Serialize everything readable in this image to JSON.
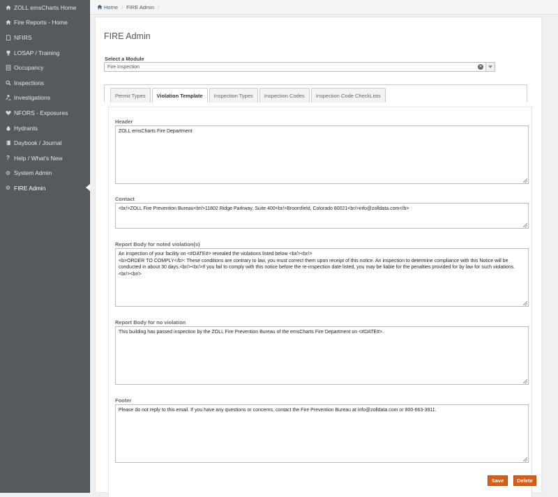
{
  "sidebar": {
    "items": [
      {
        "label": "ZOLL emsCharts Home",
        "icon": "home-icon"
      },
      {
        "label": "Fire Reports - Home",
        "icon": "home-icon"
      },
      {
        "label": "NFIRS",
        "icon": "file-icon"
      },
      {
        "label": "LOSAP / Training",
        "icon": "trophy-icon"
      },
      {
        "label": "Occupancy",
        "icon": "building-icon"
      },
      {
        "label": "Inspections",
        "icon": "search-icon"
      },
      {
        "label": "Investigations",
        "icon": "gavel-icon"
      },
      {
        "label": "NFORS - Exposures",
        "icon": "heart-icon"
      },
      {
        "label": "Hydrants",
        "icon": "tint-icon"
      },
      {
        "label": "Daybook / Journal",
        "icon": "book-icon"
      },
      {
        "label": "Help / What's New",
        "icon": "question-icon"
      },
      {
        "label": "System Admin",
        "icon": "gear-icon"
      },
      {
        "label": "FIRE Admin",
        "icon": "gear-icon",
        "active": true
      }
    ]
  },
  "breadcrumb": {
    "home": "Home",
    "current": "FIRE Admin"
  },
  "page": {
    "title": "FIRE Admin"
  },
  "module": {
    "label": "Select a Module",
    "value": "Fire Inspection"
  },
  "tabs": [
    {
      "label": "Permit Types"
    },
    {
      "label": "Violation Template",
      "active": true
    },
    {
      "label": "Inspection Types"
    },
    {
      "label": "Inspection Codes"
    },
    {
      "label": "Inspection Code CheckLists"
    }
  ],
  "form": {
    "header": {
      "label": "Header",
      "value": "ZOLL emsCharts Fire Department"
    },
    "contact": {
      "label": "Contact",
      "value": "<br/>ZOLL Fire Prevention Bureau<br/>11802 Ridge Parkway, Suite 400<br/>Broomfield, Colorado 80021<br/>info@zolldata.com</b>"
    },
    "violation": {
      "label": "Report Body for noted violation(s)",
      "value": "An inspection of your facility on <#DATE#> revealed the violations listed below <br/><br/>\n<b>ORDER TO COMPLY</b>: These conditions are contrary to law, you must correct them upon receipt of this notice. An inspection to determine compliance with this Notice will be conducted in about 30 days.<br/><br/>If you fail to comply with this notice before the re-inspection date listed, you may be liable for the penalties provided for by law for such violations.<br/><br/>"
    },
    "no_violation": {
      "label": "Report Body for no violation",
      "value": "This building has passed inspection by the ZOLL Fire Prevention Bureau of the emsCharts Fire Department on <#DATE#>."
    },
    "footer": {
      "label": "Footer",
      "value": "Please do not reply to this email. If you have any questions or concerns, contact the Fire Prevention Bureau at info@zolldata.com or 800-663-3911."
    }
  },
  "buttons": {
    "save": "Save",
    "delete": "Delete"
  },
  "colors": {
    "sidebar_bg": "#555a5f",
    "button_orange": "#d35f1a",
    "link_blue": "#2a6496"
  }
}
